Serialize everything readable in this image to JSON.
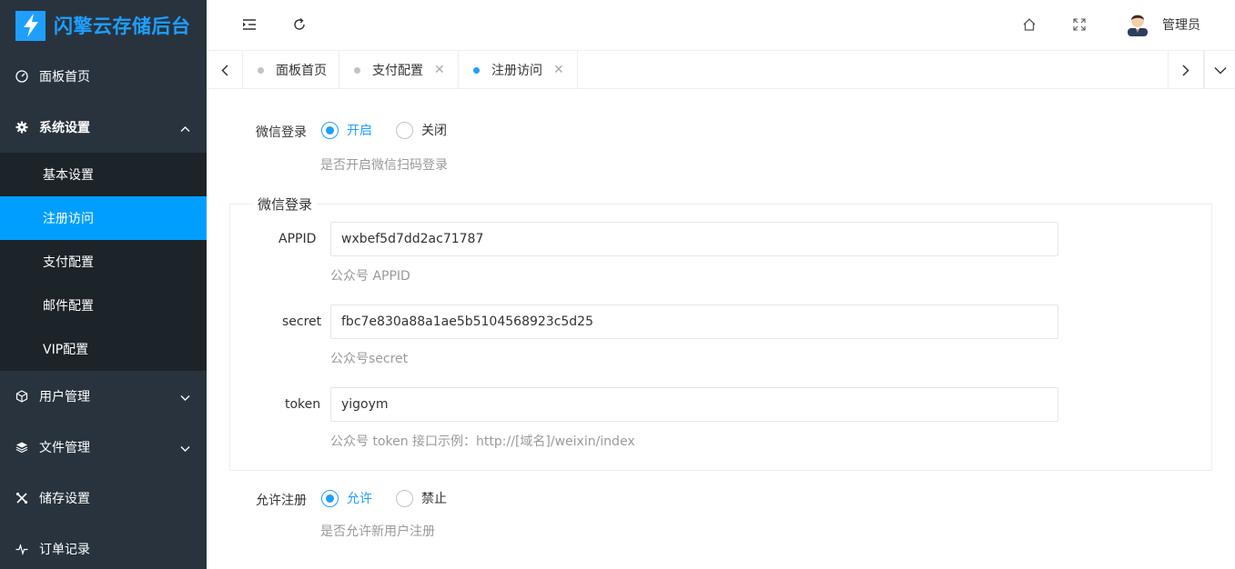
{
  "logo": {
    "text": "闪擎云存储后台"
  },
  "sidebar": {
    "items": [
      {
        "label": "面板首页",
        "icon": "dashboard-icon"
      },
      {
        "label": "系统设置",
        "icon": "gear-icon",
        "expanded": true,
        "children": [
          {
            "label": "基本设置",
            "active": false
          },
          {
            "label": "注册访问",
            "active": true
          },
          {
            "label": "支付配置",
            "active": false
          },
          {
            "label": "邮件配置",
            "active": false
          },
          {
            "label": "VIP配置",
            "active": false
          }
        ]
      },
      {
        "label": "用户管理",
        "icon": "cube-icon"
      },
      {
        "label": "文件管理",
        "icon": "layers-icon"
      },
      {
        "label": "储存设置",
        "icon": "tools-icon"
      },
      {
        "label": "订单记录",
        "icon": "pulse-icon"
      }
    ]
  },
  "header": {
    "user_name": "管理员"
  },
  "tabs": [
    {
      "label": "面板首页",
      "closable": false,
      "active": false
    },
    {
      "label": "支付配置",
      "closable": true,
      "active": false
    },
    {
      "label": "注册访问",
      "closable": true,
      "active": true
    }
  ],
  "form": {
    "wechat_login": {
      "label": "微信登录",
      "options": [
        "开启",
        "关闭"
      ],
      "selected": "开启",
      "help": "是否开启微信扫码登录"
    },
    "wechat_group": {
      "legend": "微信登录",
      "appid": {
        "label": "APPID",
        "value": "wxbef5d7dd2ac71787",
        "help": "公众号 APPID"
      },
      "secret": {
        "label": "secret",
        "value": "fbc7e830a88a1ae5b5104568923c5d25",
        "help": "公众号secret"
      },
      "token": {
        "label": "token",
        "value": "yigoym",
        "help": "公众号 token 接口示例：http://[域名]/weixin/index"
      }
    },
    "allow_register": {
      "label": "允许注册",
      "options": [
        "允许",
        "禁止"
      ],
      "selected": "允许",
      "help": "是否允许新用户注册"
    }
  },
  "colors": {
    "accent": "#1e9fff",
    "sidebar_bg": "#28333e",
    "submenu_bg": "#1c2329",
    "active_item": "#009fff"
  }
}
